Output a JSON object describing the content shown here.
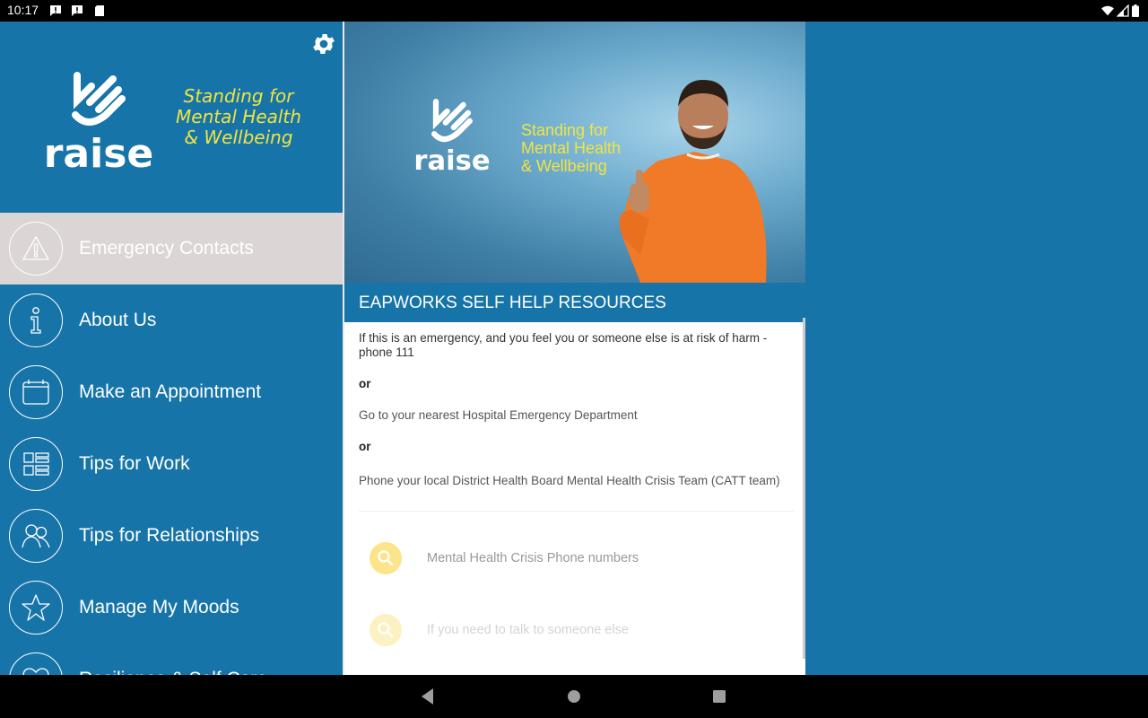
{
  "status_bar": {
    "time": "10:17",
    "left_icons": [
      "notification-alert-icon",
      "notification-alert-icon",
      "sd-card-icon"
    ],
    "right_icons": [
      "wifi-icon",
      "signal-icon",
      "battery-icon"
    ]
  },
  "drawer": {
    "settings_icon": "gear-icon",
    "logo_text": "raise",
    "tagline": [
      "Standing for",
      "Mental Health",
      "& Wellbeing"
    ],
    "items": [
      {
        "label": "Emergency Contacts",
        "icon": "warning-icon",
        "active": true
      },
      {
        "label": "About Us",
        "icon": "info-icon",
        "active": false
      },
      {
        "label": "Make an Appointment",
        "icon": "calendar-icon",
        "active": false
      },
      {
        "label": "Tips for Work",
        "icon": "list-grid-icon",
        "active": false
      },
      {
        "label": "Tips for Relationships",
        "icon": "people-icon",
        "active": false
      },
      {
        "label": "Manage My Moods",
        "icon": "star-icon",
        "active": false
      },
      {
        "label": "Resilience & Self Care",
        "icon": "heart-icon",
        "active": false
      }
    ]
  },
  "content": {
    "banner": {
      "logo_text": "raise",
      "tagline": [
        "Standing for",
        "Mental Health",
        "& Wellbeing"
      ]
    },
    "section_title": "EAPWORKS SELF HELP RESOURCES",
    "paragraphs": [
      {
        "text": "If this is an emergency, and you feel you or someone else is at risk of harm - phone 111",
        "bold": false
      },
      {
        "text": "or",
        "bold": true
      },
      {
        "text": "Go to your nearest Hospital Emergency Department",
        "bold": false
      },
      {
        "text": "or",
        "bold": true
      },
      {
        "text": "Phone your local District Health Board Mental Health Crisis Team (CATT team)",
        "bold": false
      }
    ],
    "links": [
      {
        "label": "Mental Health Crisis Phone numbers",
        "icon": "search-icon"
      },
      {
        "label": "If you need to talk to someone else",
        "icon": "search-icon"
      }
    ]
  },
  "colors": {
    "brand_blue": "#1674a8",
    "tagline_yellow": "#f0e442",
    "active_item_bg": "#dcd5d5",
    "link_icon_yellow": "#fbe48a"
  },
  "nav_bar": {
    "buttons": [
      "back-icon",
      "home-icon",
      "recents-icon"
    ]
  }
}
